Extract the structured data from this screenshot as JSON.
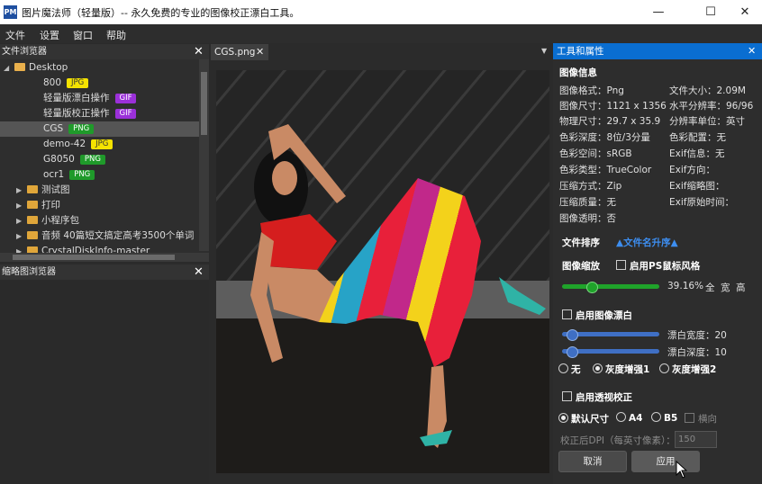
{
  "window": {
    "icon_text": "PM",
    "title": "图片魔法师（轻量版）-- 永久免费的专业的图像校正漂白工具。",
    "minimize": "—",
    "maximize": "☐",
    "close": "✕"
  },
  "menu": [
    "文件",
    "设置",
    "窗口",
    "帮助"
  ],
  "file_browser": {
    "title": "文件浏览器",
    "close": "✕",
    "root": "Desktop",
    "items": [
      {
        "name": "800",
        "badge": "JPG"
      },
      {
        "name": "轻量版漂白操作",
        "badge": "GIF"
      },
      {
        "name": "轻量版校正操作",
        "badge": "GIF"
      },
      {
        "name": "CGS",
        "badge": "PNG"
      },
      {
        "name": "demo-42",
        "badge": "JPG"
      },
      {
        "name": "G8050",
        "badge": "PNG"
      },
      {
        "name": "ocr1",
        "badge": "PNG"
      }
    ],
    "folders": [
      "测试图",
      "打印",
      "小程序包",
      "音频 40篇短文搞定高考3500个单词",
      "CrystalDiskInfo-master"
    ]
  },
  "thumb_browser": {
    "title": "缩略图浏览器",
    "close": "✕"
  },
  "document": {
    "tab_label": "CGS.png",
    "tab_close": "✕",
    "dropdown": "▼"
  },
  "properties": {
    "title": "工具和属性",
    "close": "✕",
    "image_info_title": "图像信息",
    "info_left": [
      "图像格式：Png",
      "图像尺寸：1121 x 1356",
      "物理尺寸：29.7 x 35.9",
      "色彩深度：8位/3分量",
      "色彩空间：sRGB",
      "色彩类型：TrueColor",
      "压缩方式：Zip",
      "压缩质量：无",
      "图像透明：否"
    ],
    "info_right": [
      "文件大小：2.09M",
      "水平分辨率：96/96",
      "分辨率单位：英寸",
      "色彩配置：无",
      "Exif信息：无",
      "Exif方向：",
      "Exif缩略图：",
      "Exif原始时间："
    ],
    "sort_label": "文件排序",
    "sort_value": "▲文件名升序▲",
    "zoom_label": "图像缩放",
    "ps_mouse_label": "启用PS鼠标风格",
    "zoom_value": "39.16%",
    "zoom_fraction": 0.28,
    "fit_full": "全",
    "fit_width": "宽",
    "fit_height": "高",
    "whiten_label": "启用图像漂白",
    "whiten_width_label": "漂白宽度：20",
    "whiten_width_fraction": 0.05,
    "whiten_depth_label": "漂白深度：10",
    "whiten_depth_fraction": 0.05,
    "enhance_options": [
      "无",
      "灰度增强1",
      "灰度增强2"
    ],
    "perspective_label": "启用透视校正",
    "size_options": [
      "默认尺寸",
      "A4",
      "B5"
    ],
    "landscape_label": "横向",
    "dpi_label": "校正后DPI（每英寸像素）：",
    "dpi_value": "150",
    "cancel": "取消",
    "apply": "应用"
  },
  "colors": {
    "accent_blue": "#0a6ed1",
    "zoom_slider": "#1fa32a",
    "whiten_slider": "#3f6fc4",
    "badge_jpg": "#f5e300",
    "badge_gif": "#9b30d9",
    "badge_png": "#1f9a2a"
  }
}
